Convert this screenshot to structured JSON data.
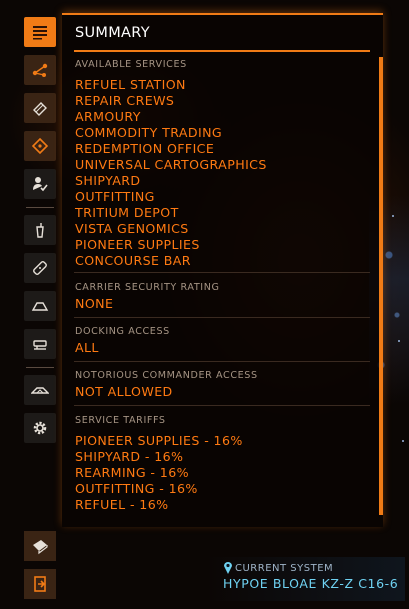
{
  "panel": {
    "title": "SUMMARY"
  },
  "sections": {
    "services": {
      "label": "AVAILABLE SERVICES",
      "items": [
        "REFUEL STATION",
        "REPAIR CREWS",
        "ARMOURY",
        "COMMODITY TRADING",
        "REDEMPTION OFFICE",
        "UNIVERSAL CARTOGRAPHICS",
        "SHIPYARD",
        "OUTFITTING",
        "TRITIUM DEPOT",
        "VISTA GENOMICS",
        "PIONEER SUPPLIES",
        "CONCOURSE BAR"
      ]
    },
    "security": {
      "label": "CARRIER SECURITY RATING",
      "value": "NONE"
    },
    "docking": {
      "label": "DOCKING ACCESS",
      "value": "ALL"
    },
    "notorious": {
      "label": "NOTORIOUS COMMANDER ACCESS",
      "value": "NOT ALLOWED"
    },
    "tariffs": {
      "label": "SERVICE TARIFFS",
      "items": [
        "PIONEER SUPPLIES - 16%",
        "SHIPYARD - 16%",
        "REARMING - 16%",
        "OUTFITTING - 16%",
        "REFUEL - 16%"
      ]
    }
  },
  "system": {
    "label": "CURRENT SYSTEM",
    "name": "HYPOE BLOAE KZ-Z C16-6"
  },
  "rail_icons": [
    "summary-icon",
    "route-icon",
    "finance-icon",
    "tag-icon",
    "crew-icon",
    "bar-icon",
    "repair-icon",
    "docking-icon",
    "carrier-icon",
    "ship-icon",
    "settings-icon"
  ],
  "colors": {
    "accent": "#f07b16",
    "value_text": "#ff7a12",
    "label_text": "#a59484",
    "system_text": "#6fd2f2"
  }
}
